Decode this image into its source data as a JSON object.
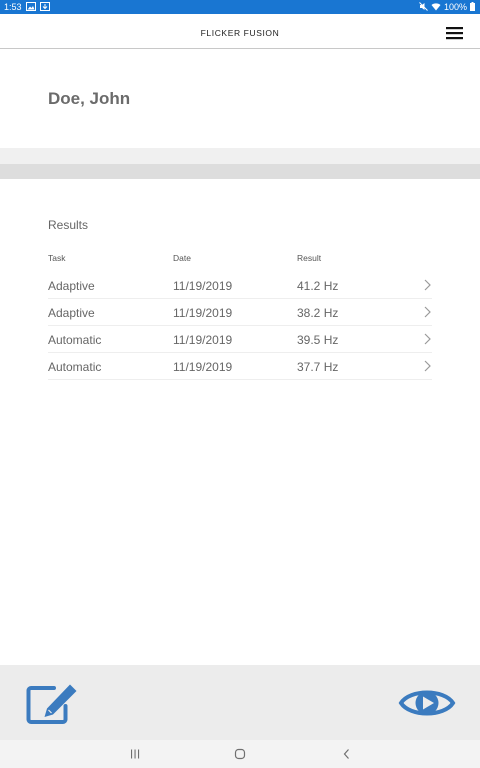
{
  "status_bar": {
    "time": "1:53",
    "battery": "100%"
  },
  "header": {
    "title": "FLICKER FUSION"
  },
  "patient": {
    "name": "Doe, John"
  },
  "results": {
    "heading": "Results",
    "columns": [
      "Task",
      "Date",
      "Result"
    ],
    "rows": [
      {
        "task": "Adaptive",
        "date": "11/19/2019",
        "result": "41.2 Hz"
      },
      {
        "task": "Adaptive",
        "date": "11/19/2019",
        "result": "38.2 Hz"
      },
      {
        "task": "Automatic",
        "date": "11/19/2019",
        "result": "39.5 Hz"
      },
      {
        "task": "Automatic",
        "date": "11/19/2019",
        "result": "37.7 Hz"
      }
    ]
  },
  "toolbar": {
    "edit_icon": "edit-icon",
    "view_icon": "eye-play-icon"
  },
  "colors": {
    "status_bar": "#1976d2",
    "accent": "#3b7bbf",
    "toolbar_bg": "#ececec",
    "divider_band": "#dddddd"
  }
}
